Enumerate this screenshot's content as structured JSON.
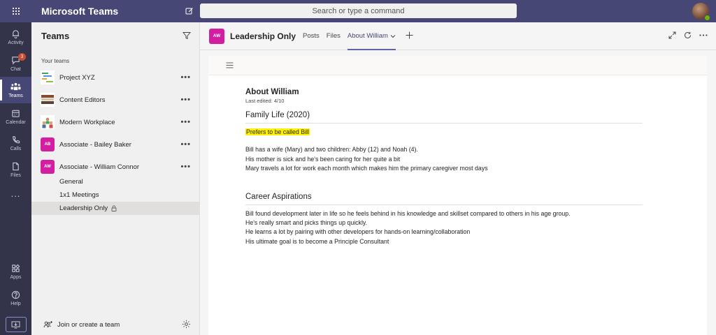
{
  "topbar": {
    "app_title": "Microsoft Teams",
    "search_placeholder": "Search or type a command"
  },
  "rail": {
    "items": [
      {
        "label": "Activity",
        "icon": "bell-icon"
      },
      {
        "label": "Chat",
        "icon": "chat-icon",
        "badge": "3"
      },
      {
        "label": "Teams",
        "icon": "teams-icon",
        "active": true
      },
      {
        "label": "Calendar",
        "icon": "calendar-icon"
      },
      {
        "label": "Calls",
        "icon": "phone-icon"
      },
      {
        "label": "Files",
        "icon": "file-icon"
      },
      {
        "label": "...",
        "icon": "more-icon"
      }
    ],
    "bottom": [
      {
        "label": "Apps",
        "icon": "apps-icon"
      },
      {
        "label": "Help",
        "icon": "help-icon"
      }
    ]
  },
  "panel": {
    "title": "Teams",
    "section_label": "Your teams",
    "teams": [
      {
        "name": "Project XYZ",
        "more": "•••"
      },
      {
        "name": "Content Editors",
        "more": "•••"
      },
      {
        "name": "Modern Workplace",
        "more": "•••"
      },
      {
        "name": "Associate - Bailey Baker",
        "initials": "AB",
        "more": "•••"
      },
      {
        "name": "Associate - William Connor",
        "initials": "AW",
        "more": "•••"
      }
    ],
    "channels": [
      "General",
      "1x1 Meetings",
      "Leadership Only"
    ],
    "footer": {
      "join_label": "Join or create a team"
    }
  },
  "channel_header": {
    "avatar_initials": "AW",
    "title": "Leadership Only",
    "tabs": [
      "Posts",
      "Files",
      "About William"
    ]
  },
  "document": {
    "title": "About William",
    "last_edited": "Last edited: 4/10",
    "sections": [
      {
        "heading": "Family Life (2020)",
        "highlight": "Prefers to be called Bill",
        "lines": [
          "Bill has a wife (Mary) and two children: Abby (12) and Noah (4).",
          "His mother is sick and he's been caring for her quite a bit",
          "Mary travels a lot for work each month which makes him the primary caregiver most days"
        ]
      },
      {
        "heading": "Career Aspirations",
        "lines": [
          "Bill found development later in life so he feels behind in his knowledge and skillset compared to others in his age group.",
          "He's really smart and picks things up quickly.",
          "He learns a lot by pairing with other developers for hands-on learning/collaboration",
          "His ultimate goal is to become a Principle Consultant"
        ]
      }
    ]
  },
  "colors": {
    "topbar": "#464775",
    "rail": "#33344a",
    "accent": "#6264a7",
    "avatar_magenta": "#d41ea1",
    "highlight": "#fff100",
    "badge": "#cc4a31"
  }
}
